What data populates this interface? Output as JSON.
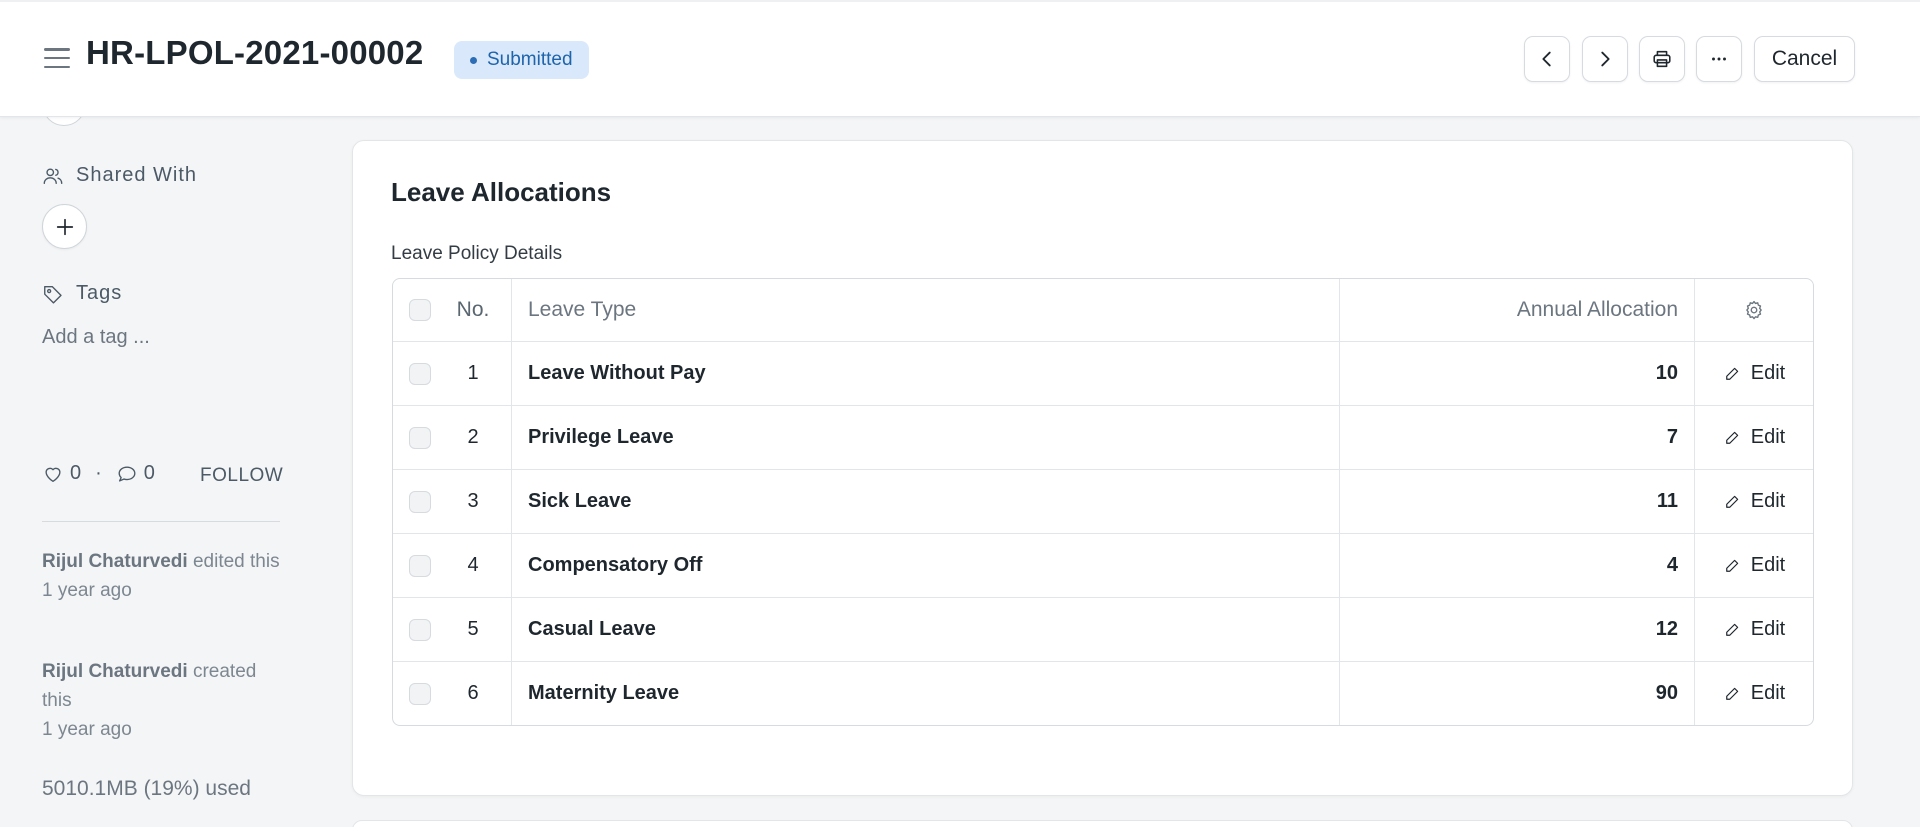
{
  "header": {
    "doc_title": "HR-LPOL-2021-00002",
    "status": "Submitted",
    "cancel_label": "Cancel",
    "icons": [
      "hamburger-icon",
      "chevron-left-icon",
      "chevron-right-icon",
      "printer-icon",
      "more-icon"
    ],
    "status_colors": {
      "bg": "#d9e9fb",
      "text": "#1e64ab"
    }
  },
  "sidebar": {
    "shared_with_label": "Shared With",
    "tags_label": "Tags",
    "add_tag_placeholder": "Add a tag ...",
    "likes_count": "0",
    "separator": "·",
    "comments_count": "0",
    "follow_label": "FOLLOW",
    "activity": [
      {
        "user": "Rijul Chaturvedi",
        "action": "edited this",
        "time": "1 year ago"
      },
      {
        "user": "Rijul Chaturvedi",
        "action": "created this",
        "time": "1 year ago"
      }
    ],
    "storage_usage": "5010.1MB (19%) used"
  },
  "main": {
    "section_title": "Leave Allocations",
    "table_label": "Leave Policy Details",
    "columns": {
      "no": "No.",
      "leave_type": "Leave Type",
      "annual_allocation": "Annual Allocation"
    },
    "edit_label": "Edit",
    "rows": [
      {
        "no": "1",
        "leave_type": "Leave Without Pay",
        "annual_allocation": "10"
      },
      {
        "no": "2",
        "leave_type": "Privilege Leave",
        "annual_allocation": "7"
      },
      {
        "no": "3",
        "leave_type": "Sick Leave",
        "annual_allocation": "11"
      },
      {
        "no": "4",
        "leave_type": "Compensatory Off",
        "annual_allocation": "4"
      },
      {
        "no": "5",
        "leave_type": "Casual Leave",
        "annual_allocation": "12"
      },
      {
        "no": "6",
        "leave_type": "Maternity Leave",
        "annual_allocation": "90"
      }
    ]
  }
}
